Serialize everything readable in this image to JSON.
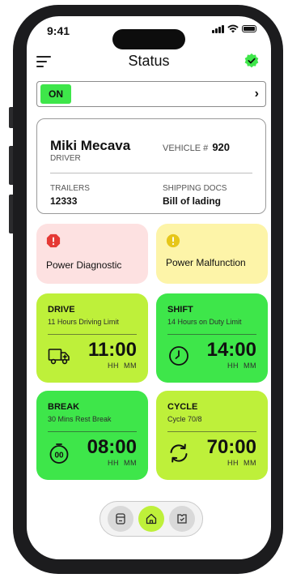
{
  "status_bar": {
    "time": "9:41"
  },
  "header": {
    "title": "Status"
  },
  "duty_toggle": {
    "state": "ON"
  },
  "driver_card": {
    "name": "Miki Mecava",
    "role": "DRIVER",
    "vehicle_label": "VEHICLE #",
    "vehicle_number": "920",
    "trailers_label": "TRAILERS",
    "trailers_value": "12333",
    "shipping_docs_label": "SHIPPING DOCS",
    "shipping_docs_value": "Bill of lading"
  },
  "alerts": [
    {
      "label": "Power Diagnostic",
      "icon": "error-icon",
      "color": "#fde1e1",
      "icon_color": "#e53935"
    },
    {
      "label": "Power Malfunction",
      "icon": "warning-icon",
      "color": "#fdf4a8",
      "icon_color": "#e6c619"
    }
  ],
  "timers": [
    {
      "title": "DRIVE",
      "subtitle": "11 Hours Driving Limit",
      "time": "11:00",
      "units": "HH  MM",
      "icon": "truck-icon",
      "color": "#bef03a"
    },
    {
      "title": "SHIFT",
      "subtitle": "14 Hours on Duty Limit",
      "time": "14:00",
      "units": "HH  MM",
      "icon": "clock-icon",
      "color": "#3ee64a"
    },
    {
      "title": "BREAK",
      "subtitle": "30 Mins Rest Break",
      "time": "08:00",
      "units": "HH  MM",
      "icon": "stopwatch-icon",
      "color": "#3ee64a"
    },
    {
      "title": "CYCLE",
      "subtitle": "Cycle 70/8",
      "time": "70:00",
      "units": "HH  MM",
      "icon": "cycle-icon",
      "color": "#bef03a"
    }
  ],
  "bottom_nav": {
    "items": [
      {
        "icon": "logbook-icon",
        "active": false
      },
      {
        "icon": "home-icon",
        "active": true
      },
      {
        "icon": "inspection-icon",
        "active": false
      }
    ]
  },
  "colors": {
    "accent_lime": "#bef03a",
    "accent_green": "#3ee64a",
    "verified_badge": "#3ee64a"
  }
}
